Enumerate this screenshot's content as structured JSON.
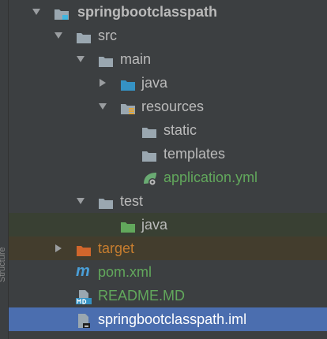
{
  "gutter": {
    "label": "Structure"
  },
  "tree": {
    "root": {
      "label": "springbootclasspath"
    },
    "src": {
      "label": "src"
    },
    "main": {
      "label": "main"
    },
    "main_java": {
      "label": "java"
    },
    "resources": {
      "label": "resources"
    },
    "static": {
      "label": "static"
    },
    "templates": {
      "label": "templates"
    },
    "application": {
      "label": "application.yml"
    },
    "test": {
      "label": "test"
    },
    "test_java": {
      "label": "java"
    },
    "target": {
      "label": "target"
    },
    "pom": {
      "label": "pom.xml"
    },
    "readme": {
      "label": "README.MD"
    },
    "iml": {
      "label": "springbootclasspath.iml"
    }
  },
  "colors": {
    "background": "#3c3f41",
    "text": "#bbbbbb",
    "source_folder": "#3592c4",
    "test_folder": "#62a85c",
    "excluded_folder": "#c87e2f",
    "selection": "#4b6eaf"
  },
  "icons": {
    "expanded": "chevron-down-icon",
    "collapsed": "chevron-right-icon",
    "folder": "folder-icon",
    "module": "module-icon",
    "resources": "resources-folder-icon",
    "yaml": "spring-config-icon",
    "maven": "maven-icon",
    "markdown": "markdown-icon",
    "iml": "iml-file-icon"
  }
}
